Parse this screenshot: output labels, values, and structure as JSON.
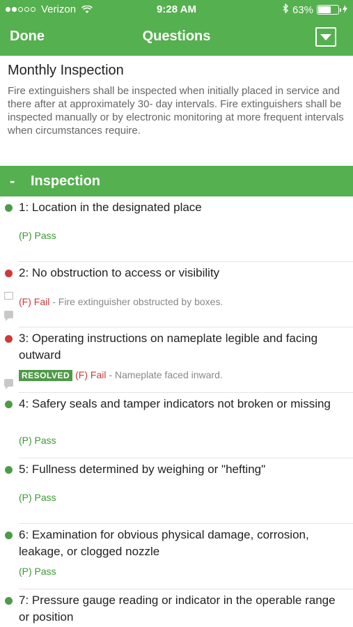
{
  "status_bar": {
    "carrier": "Verizon",
    "time": "9:28 AM",
    "battery": "63%",
    "battery_level": 0.63,
    "signal_bars": 2
  },
  "nav": {
    "done_label": "Done",
    "title": "Questions",
    "menu_icon": "dropdown-icon"
  },
  "intro": {
    "title": "Monthly Inspection",
    "description": "Fire extinguishers shall be inspected when initially placed in service and there after at approximately 30- day intervals. Fire extinguishers shall be inspected manually or by electronic monitoring at more frequent intervals when circumstances require."
  },
  "section": {
    "toggle": "-",
    "title": "Inspection"
  },
  "colors": {
    "accent": "#55b04f",
    "pass": "#3a9a33",
    "fail": "#cc3a3a"
  },
  "questions": [
    {
      "text": "1: Location in the designated place",
      "status": "pass",
      "answer": "(P) Pass"
    },
    {
      "text": "2: No obstruction to access or visibility",
      "status": "fail",
      "answer": "(F) Fail",
      "note": " - Fire extinguisher obstructed by boxes."
    },
    {
      "text": "3: Operating instructions on nameplate legible and facing outward",
      "status": "fail",
      "badge": "RESOLVED",
      "answer": "(F) Fail",
      "note": " - Nameplate faced inward."
    },
    {
      "text": "4: Safery seals and tamper indicators not broken or missing",
      "status": "pass",
      "answer": "(P) Pass"
    },
    {
      "text": "5: Fullness determined by weighing or \"hefting\"",
      "status": "pass",
      "answer": "(P) Pass"
    },
    {
      "text": "6: Examination for obvious physical damage, corrosion, leakage, or clogged nozzle",
      "status": "pass",
      "answer": "(P) Pass"
    },
    {
      "text": "7: Pressure gauge reading or indicator in the operable range or position",
      "status": "pass"
    }
  ]
}
